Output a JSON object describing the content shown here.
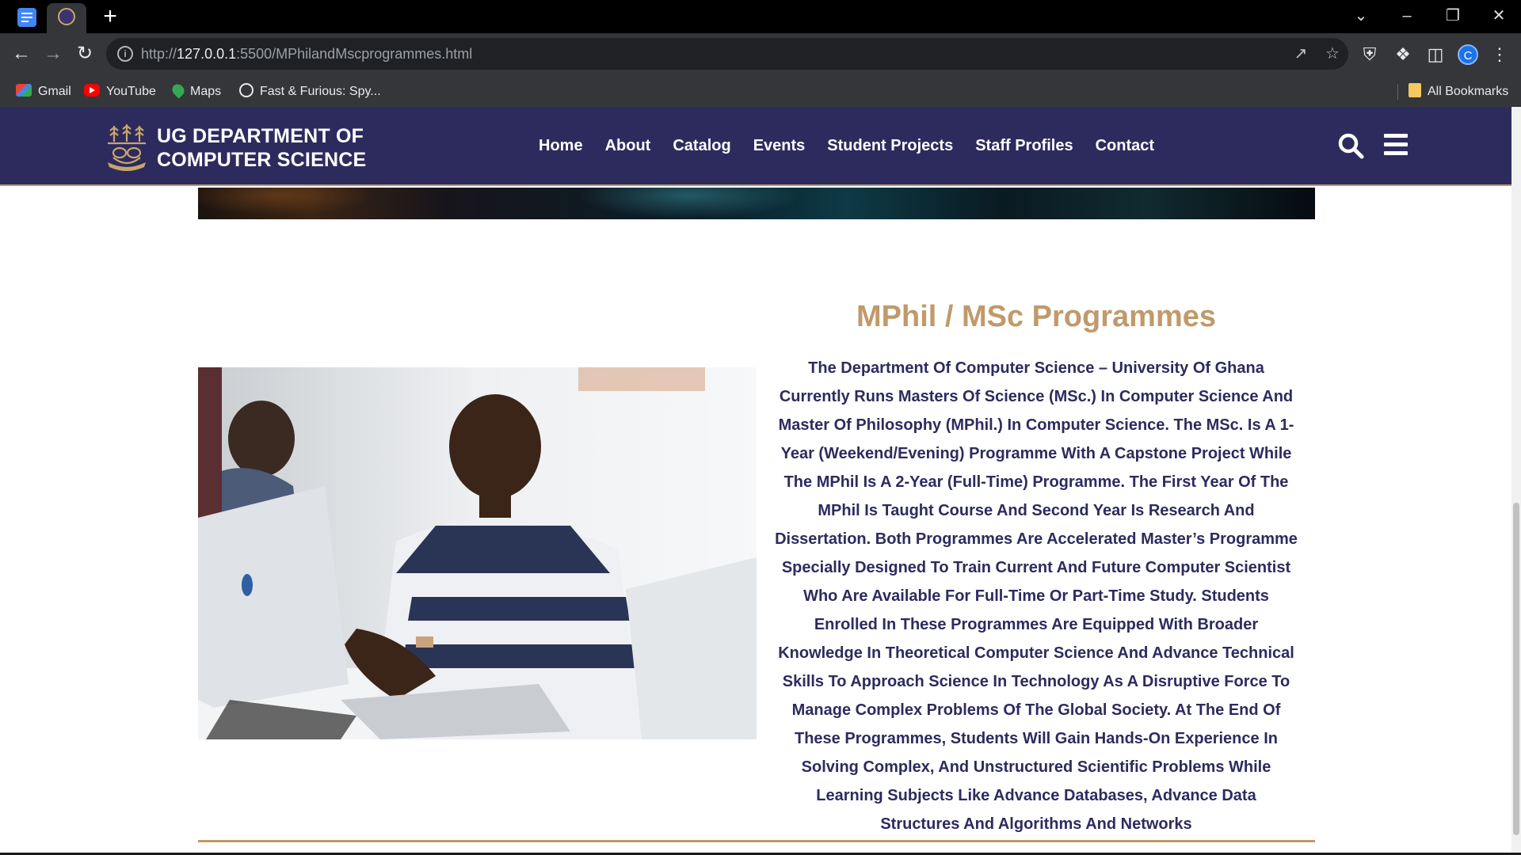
{
  "browser": {
    "url_prefix": "http://",
    "url_host": "127.0.0.1",
    "url_rest": ":5500/MPhilandMscprogrammes.html",
    "profile_initial": "C",
    "bookmarks": [
      {
        "label": "Gmail",
        "icon": "gmail-icon"
      },
      {
        "label": "YouTube",
        "icon": "youtube-icon"
      },
      {
        "label": "Maps",
        "icon": "maps-icon"
      },
      {
        "label": "Fast & Furious: Spy...",
        "icon": "globe-icon"
      }
    ],
    "all_bookmarks": "All Bookmarks"
  },
  "site": {
    "title_line1": "UG DEPARTMENT OF",
    "title_line2": "COMPUTER SCIENCE",
    "nav": [
      "Home",
      "About",
      "Catalog",
      "Events",
      "Student Projects",
      "Staff Profiles",
      "Contact"
    ],
    "colors": {
      "header": "#2d2b5e",
      "accent_gold": "#c09a6b",
      "body_text": "#2d2b5e"
    }
  },
  "content": {
    "heading": "MPhil / MSc Programmes",
    "body": "The Department Of Computer Science – University Of Ghana Currently Runs Masters Of Science (MSc.) In Computer Science And Master Of Philosophy (MPhil.) In Computer Science. The MSc. Is A 1-Year (Weekend/Evening) Programme With A Capstone Project While The MPhil Is A 2-Year (Full-Time) Programme. The First Year Of The MPhil Is Taught Course And Second Year Is Research And Dissertation. Both Programmes Are Accelerated Master’s Programme Specially Designed To Train Current And Future Computer Scientist Who Are Available For Full-Time Or Part-Time Study. Students Enrolled In These Programmes Are Equipped With Broader Knowledge In Theoretical Computer Science And Advance Technical Skills To Approach Science In Technology As A Disruptive Force To Manage Complex Problems Of The Global Society. At The End Of These Programmes, Students Will Gain Hands-On Experience In Solving Complex, And Unstructured Scientific Problems While Learning Subjects Like Advance Databases, Advance Data Structures And Algorithms And Networks"
  }
}
